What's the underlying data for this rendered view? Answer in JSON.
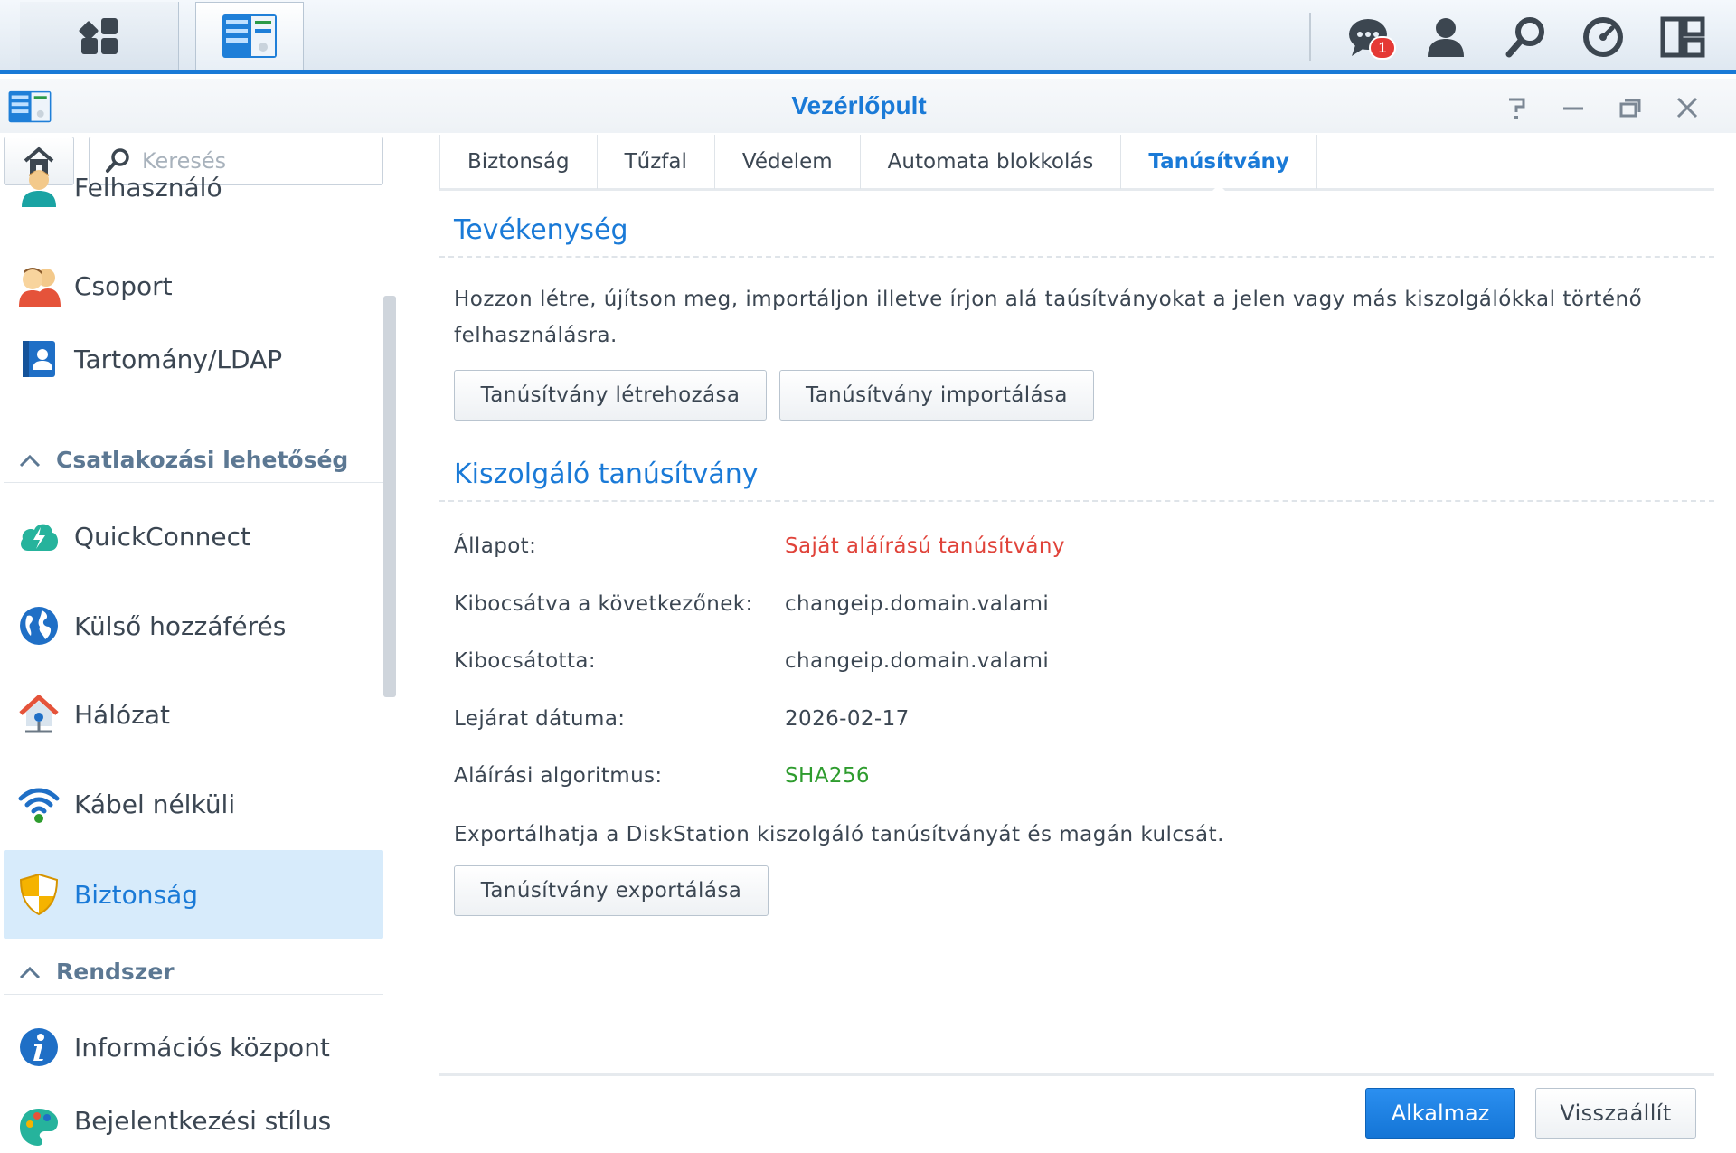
{
  "taskbar": {
    "notification_count": "1",
    "icons": [
      "main-menu-icon",
      "control-panel-icon",
      "notification-icon",
      "user-icon",
      "search-icon",
      "widgets-icon",
      "layout-icon"
    ]
  },
  "window": {
    "title": "Vezérlőpult",
    "controls": [
      "help-icon",
      "minimize-icon",
      "maximize-icon",
      "close-icon"
    ]
  },
  "sidebar": {
    "search_placeholder": "Keresés",
    "items_top": [
      {
        "label": "Felhasználó",
        "icon": "user-icon"
      },
      {
        "label": "Csoport",
        "icon": "group-icon"
      },
      {
        "label": "Tartomány/LDAP",
        "icon": "directory-icon"
      }
    ],
    "section_connectivity": "Csatlakozási lehetőség",
    "items_connectivity": [
      {
        "label": "QuickConnect",
        "icon": "quickconnect-icon"
      },
      {
        "label": "Külső hozzáférés",
        "icon": "globe-icon"
      },
      {
        "label": "Hálózat",
        "icon": "network-house-icon"
      },
      {
        "label": "Kábel nélküli",
        "icon": "wifi-icon"
      },
      {
        "label": "Biztonság",
        "icon": "shield-icon",
        "active": true
      }
    ],
    "section_system": "Rendszer",
    "items_system": [
      {
        "label": "Információs központ",
        "icon": "info-icon"
      },
      {
        "label": "Bejelentkezési stílus",
        "icon": "palette-icon"
      }
    ]
  },
  "tabs": [
    {
      "label": "Biztonság"
    },
    {
      "label": "Tűzfal"
    },
    {
      "label": "Védelem"
    },
    {
      "label": "Automata blokkolás"
    },
    {
      "label": "Tanúsítvány",
      "active": true
    }
  ],
  "activity": {
    "title": "Tevékenység",
    "description": "Hozzon létre, újítson meg, importáljon illetve írjon alá taúsítványokat a jelen vagy más kiszolgálókkal történő felhasználásra.",
    "create_button": "Tanúsítvány létrehozása",
    "import_button": "Tanúsítvány importálása"
  },
  "server_cert": {
    "title": "Kiszolgáló tanúsítvány",
    "rows": [
      {
        "label": "Állapot:",
        "value": "Saját aláírású tanúsítvány",
        "color": "#e0433a"
      },
      {
        "label": "Kibocsátva a következőnek:",
        "value": "changeip.domain.valami"
      },
      {
        "label": "Kibocsátotta:",
        "value": "changeip.domain.valami"
      },
      {
        "label": "Lejárat dátuma:",
        "value": "2026-02-17"
      },
      {
        "label": "Aláírási algoritmus:",
        "value": "SHA256",
        "color": "#2e9c2e"
      }
    ],
    "export_note": "Exportálhatja a DiskStation kiszolgáló tanúsítványát és magán kulcsát.",
    "export_button": "Tanúsítvány exportálása"
  },
  "footer": {
    "apply_button": "Alkalmaz",
    "reset_button": "Visszaállít"
  },
  "colors": {
    "accent": "#1a7ad7",
    "status_red": "#e0433a",
    "status_green": "#2e9c2e",
    "active_bg": "#d7ebfb"
  }
}
